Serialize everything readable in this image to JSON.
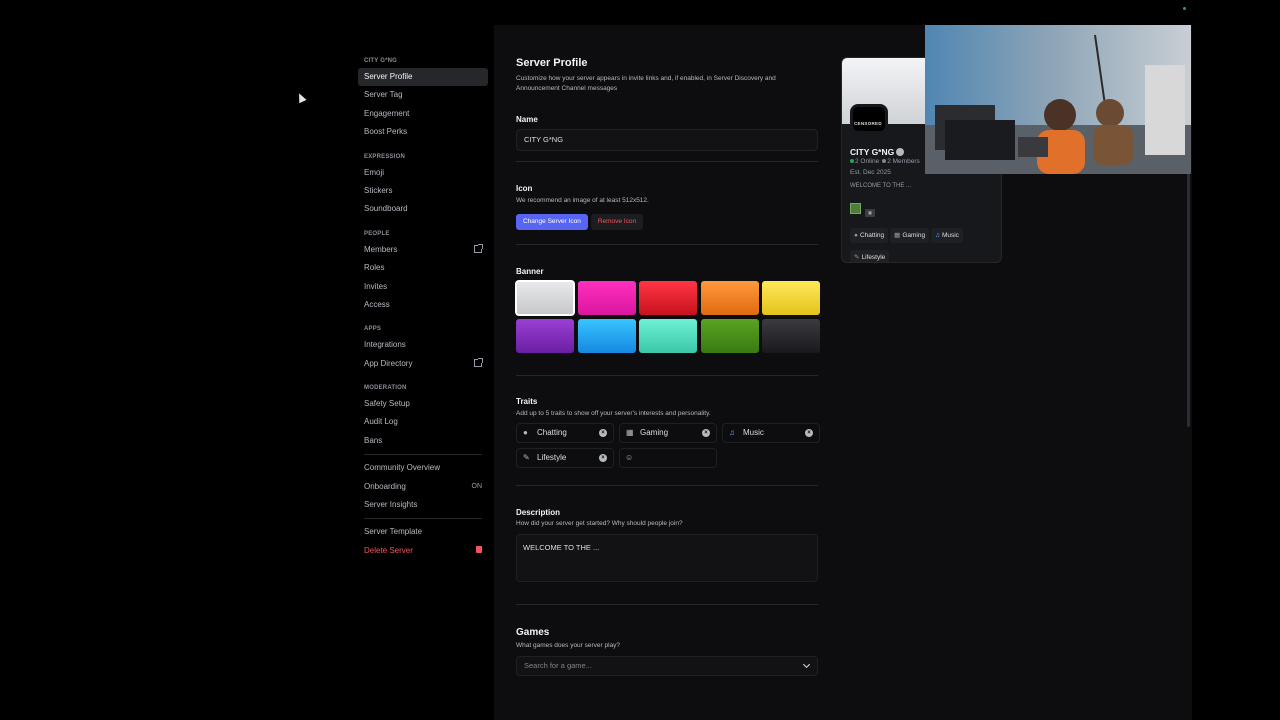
{
  "sidebar": {
    "sections": [
      {
        "heading": "CITY G*NG",
        "items": [
          {
            "label": "Server Profile",
            "active": true
          },
          {
            "label": "Server Tag"
          },
          {
            "label": "Engagement"
          },
          {
            "label": "Boost Perks"
          }
        ]
      },
      {
        "heading": "EXPRESSION",
        "items": [
          {
            "label": "Emoji"
          },
          {
            "label": "Stickers"
          },
          {
            "label": "Soundboard"
          }
        ]
      },
      {
        "heading": "PEOPLE",
        "items": [
          {
            "label": "Members",
            "icon": "external-link-icon"
          },
          {
            "label": "Roles"
          },
          {
            "label": "Invites"
          },
          {
            "label": "Access"
          }
        ]
      },
      {
        "heading": "APPS",
        "items": [
          {
            "label": "Integrations"
          },
          {
            "label": "App Directory",
            "icon": "external-link-icon"
          }
        ]
      },
      {
        "heading": "MODERATION",
        "items": [
          {
            "label": "Safety Setup"
          },
          {
            "label": "Audit Log"
          },
          {
            "label": "Bans"
          }
        ]
      }
    ],
    "community": [
      {
        "label": "Community Overview"
      },
      {
        "label": "Onboarding",
        "status": "ON"
      },
      {
        "label": "Server Insights"
      }
    ],
    "footer": [
      {
        "label": "Server Template"
      },
      {
        "label": "Delete Server",
        "icon": "trash-icon",
        "danger": true
      }
    ]
  },
  "profile": {
    "title": "Server Profile",
    "subtitle": "Customize how your server appears in invite links and, if enabled, in Server Discovery and Announcement Channel messages",
    "name_label": "Name",
    "name_value": "CITY G*NG",
    "icon_label": "Icon",
    "icon_hint": "We recommend an image of at least 512x512.",
    "change_icon_button": "Change Server Icon",
    "remove_icon_button": "Remove Icon",
    "banner_label": "Banner",
    "banner_colors": [
      [
        "#e9eaec",
        "#c4c6c9"
      ],
      [
        "#ff2fbf",
        "#d9169e"
      ],
      [
        "#ff3644",
        "#c8121f"
      ],
      [
        "#ff9a3c",
        "#e06a10"
      ],
      [
        "#ffe95a",
        "#e3c21a"
      ],
      [
        "#9a3fd4",
        "#6b1fa3"
      ],
      [
        "#39c4ff",
        "#1588e0"
      ],
      [
        "#6ff0d3",
        "#3ac7a8"
      ],
      [
        "#5aa323",
        "#3a7a12"
      ],
      [
        "#3c3c40",
        "#1a1a1d"
      ]
    ],
    "selected_banner": 0,
    "traits_label": "Traits",
    "traits_hint": "Add up to 5 traits to show off your server's interests and personality.",
    "traits": [
      {
        "label": "Chatting",
        "icon": "speech-bubble-icon"
      },
      {
        "label": "Gaming",
        "icon": "controller-icon"
      },
      {
        "label": "Music",
        "icon": "music-note-icon"
      },
      {
        "label": "Lifestyle",
        "icon": "paintbrush-icon"
      }
    ],
    "description_label": "Description",
    "description_hint": "How did your server get started? Why should people join?",
    "description_value": "WELCOME TO THE ...",
    "games_label": "Games",
    "games_hint": "What games does your server play?",
    "games_placeholder": "Search for a game..."
  },
  "preview": {
    "censored_text": "CENSORED",
    "name": "CITY G*NG",
    "online": "2 Online",
    "members": "2 Members",
    "established": "Est. Dec 2025",
    "description": "WELCOME TO THE ...",
    "traits": [
      {
        "label": "Chatting",
        "icon": "speech-bubble-icon"
      },
      {
        "label": "Gaming",
        "icon": "controller-icon"
      },
      {
        "label": "Music",
        "icon": "music-note-icon"
      },
      {
        "label": "Lifestyle",
        "icon": "paintbrush-icon"
      }
    ]
  }
}
